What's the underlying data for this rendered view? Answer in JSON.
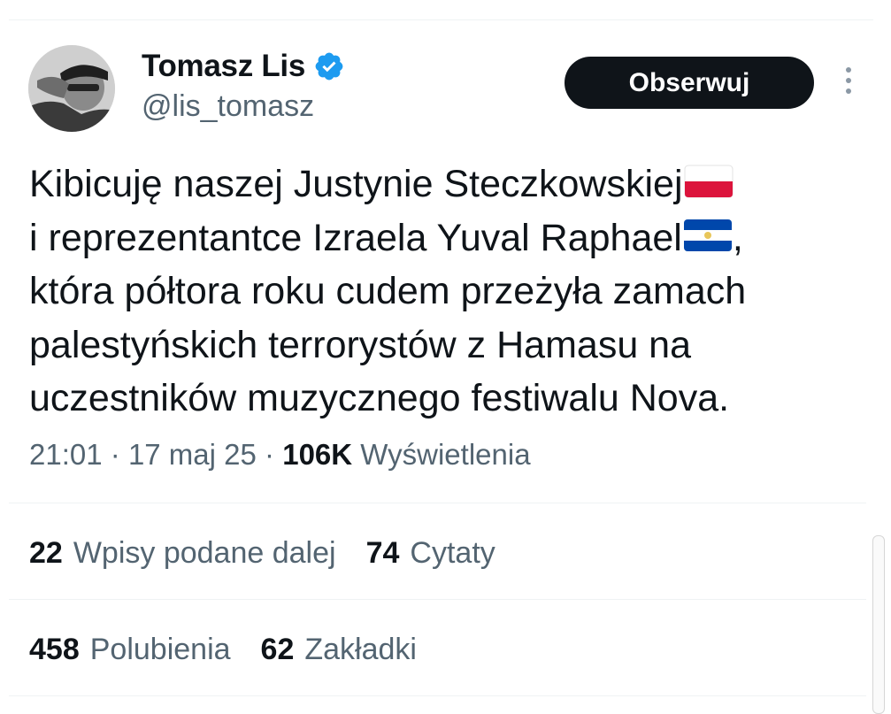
{
  "author": {
    "name": "Tomasz Lis",
    "handle": "@lis_tomasz",
    "verified_icon": "verified-badge-icon",
    "avatar_icon": "avatar-photo"
  },
  "actions": {
    "follow_label": "Obserwuj",
    "more_icon": "more-vertical-icon"
  },
  "tweet": {
    "lines": [
      "Kibicuję naszej Justynie Steczkowskiej",
      "i reprezentantce Izraela Yuval Raphael",
      ",",
      "która półtora roku cudem przeżyła zamach",
      "palestyńskich terrorystów z Hamasu na",
      "uczestników muzycznego festiwalu Nova."
    ],
    "emoji": {
      "line1_end": "flag-poland",
      "line2_end": "flag-el-salvador"
    }
  },
  "meta": {
    "time": "21:01",
    "separator": "·",
    "date": "17 maj 25",
    "views_count": "106K",
    "views_label": "Wyświetlenia"
  },
  "stats": {
    "reposts_count": "22",
    "reposts_label": "Wpisy podane dalej",
    "quotes_count": "74",
    "quotes_label": "Cytaty",
    "likes_count": "458",
    "likes_label": "Polubienia",
    "bookmarks_count": "62",
    "bookmarks_label": "Zakładki"
  },
  "colors": {
    "text_primary": "#0f1419",
    "text_secondary": "#536471",
    "verified_blue": "#1d9bf0",
    "button_bg": "#0f1419",
    "divider": "#eff3f4"
  }
}
